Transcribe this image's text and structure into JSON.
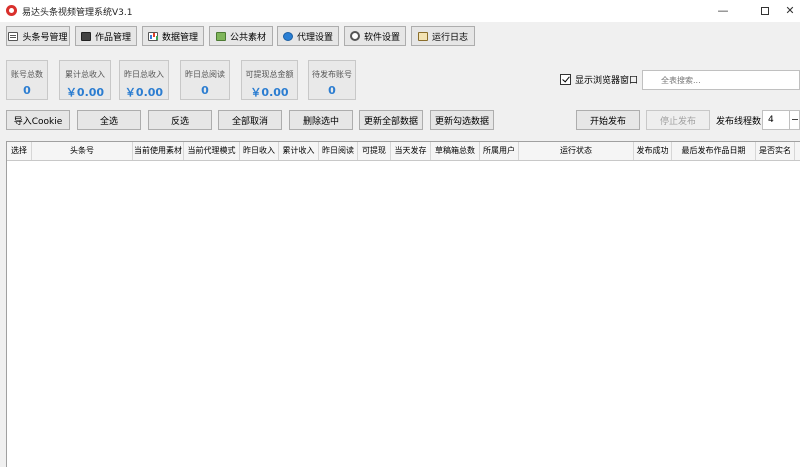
{
  "window": {
    "title": "易达头条视频管理系统V3.1",
    "controls": {
      "minimize": "—",
      "maximize": "",
      "close": "✕"
    }
  },
  "toolbar": [
    {
      "label": "头条号管理",
      "icon": "document-icon"
    },
    {
      "label": "作品管理",
      "icon": "film-icon"
    },
    {
      "label": "数据管理",
      "icon": "chart-icon"
    },
    {
      "label": "公共素材",
      "icon": "picture-icon"
    },
    {
      "label": "代理设置",
      "icon": "globe-icon"
    },
    {
      "label": "软件设置",
      "icon": "gear-icon"
    },
    {
      "label": "运行日志",
      "icon": "log-icon"
    }
  ],
  "stats": [
    {
      "label": "账号总数",
      "value": "0"
    },
    {
      "label": "累计总收入",
      "value": "￥0.00"
    },
    {
      "label": "昨日总收入",
      "value": "￥0.00"
    },
    {
      "label": "昨日总阅读",
      "value": "0"
    },
    {
      "label": "可提现总金额",
      "value": "￥0.00"
    },
    {
      "label": "待发布账号",
      "value": "0"
    }
  ],
  "options": {
    "show_browser_label": "显示浏览器窗口",
    "show_browser_checked": true,
    "search_placeholder": "全表搜索..."
  },
  "actions": {
    "import_cookie": "导入Cookie",
    "select_all": "全选",
    "invert": "反选",
    "deselect_all": "全部取消",
    "delete_selected": "删除选中",
    "update_all": "更新全部数据",
    "update_checked": "更新勾选数据",
    "start_publish": "开始发布",
    "stop_publish": "停止发布",
    "threads_label": "发布线程数:",
    "threads_value": "4"
  },
  "table": {
    "columns": [
      "选择",
      "头条号",
      "当前使用素材",
      "当前代理模式",
      "昨日收入",
      "累计收入",
      "昨日阅读",
      "可提现",
      "当天发存",
      "草稿箱总数",
      "所属用户",
      "运行状态",
      "发布成功",
      "最后发布作品日期",
      "是否实名"
    ],
    "rows": []
  }
}
